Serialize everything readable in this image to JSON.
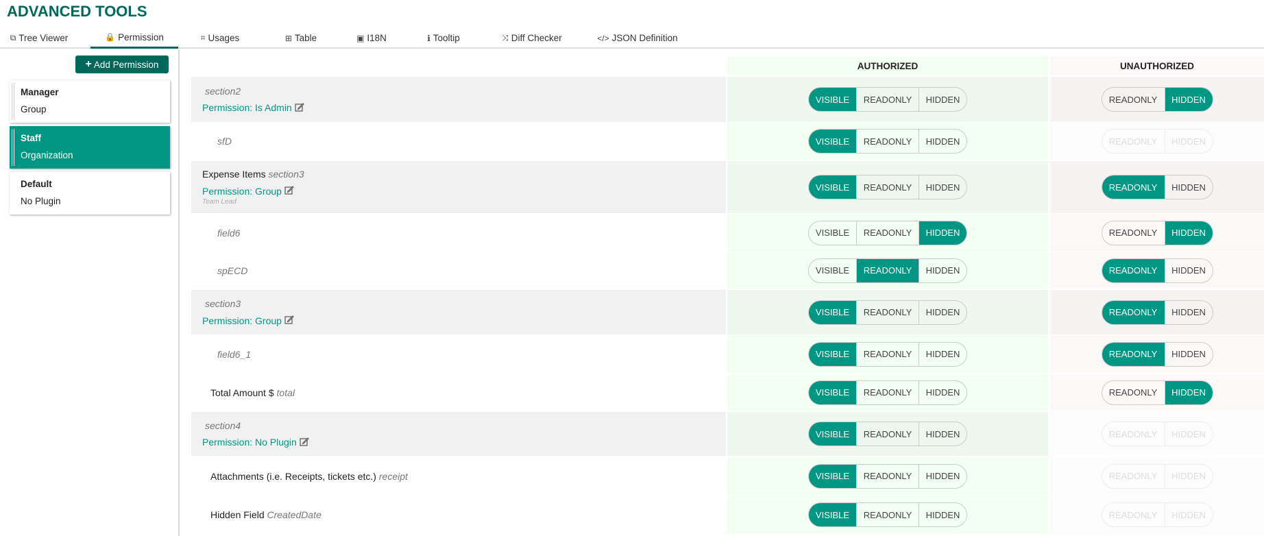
{
  "title": "ADVANCED TOOLS",
  "tabs": [
    {
      "label": "Tree Viewer",
      "icon": "sitemap-icon",
      "glyph": "⧉"
    },
    {
      "label": "Permission",
      "icon": "lock-icon",
      "glyph": "🔒"
    },
    {
      "label": "Usages",
      "icon": "binoculars-icon",
      "glyph": "⌗"
    },
    {
      "label": "Table",
      "icon": "table-icon",
      "glyph": "⊞"
    },
    {
      "label": "I18N",
      "icon": "language-icon",
      "glyph": "▣"
    },
    {
      "label": "Tooltip",
      "icon": "info-icon",
      "glyph": "ℹ"
    },
    {
      "label": "Diff Checker",
      "icon": "random-icon",
      "glyph": "⤨"
    },
    {
      "label": "JSON Definition",
      "icon": "code-icon",
      "glyph": "</>"
    }
  ],
  "add_permission": "Add Permission",
  "roles": [
    {
      "name": "Manager",
      "type": "Group"
    },
    {
      "name": "Staff",
      "type": "Organization"
    },
    {
      "name": "Default",
      "type": "No Plugin"
    }
  ],
  "columns": {
    "authorized": "AUTHORIZED",
    "unauthorized": "UNAUTHORIZED"
  },
  "options": {
    "visible": "VISIBLE",
    "readonly": "READONLY",
    "hidden": "HIDDEN"
  },
  "rows": [
    {
      "kind": "section",
      "label": "",
      "id": "section2",
      "permission": "Permission: Is Admin",
      "note": "",
      "auth": "visible",
      "unauth": "hidden",
      "unauth_disabled": false
    },
    {
      "kind": "field",
      "label": "",
      "id": "sfD",
      "auth": "visible",
      "unauth": "",
      "unauth_disabled": true
    },
    {
      "kind": "section",
      "label": "Expense Items",
      "id": "section3",
      "permission": "Permission: Group",
      "note": "Team Lead",
      "auth": "visible",
      "unauth": "readonly",
      "unauth_disabled": false
    },
    {
      "kind": "field",
      "label": "",
      "id": "field6",
      "auth": "hidden",
      "unauth": "hidden",
      "unauth_disabled": false
    },
    {
      "kind": "field",
      "label": "",
      "id": "spECD",
      "auth": "readonly",
      "unauth": "readonly",
      "unauth_disabled": false
    },
    {
      "kind": "section",
      "label": "",
      "id": "section3",
      "permission": "Permission: Group",
      "note": "",
      "auth": "visible",
      "unauth": "readonly",
      "unauth_disabled": false
    },
    {
      "kind": "field",
      "label": "",
      "id": "field6_1",
      "auth": "visible",
      "unauth": "readonly",
      "unauth_disabled": false
    },
    {
      "kind": "field2",
      "label": "Total Amount $",
      "id": "total",
      "auth": "visible",
      "unauth": "hidden",
      "unauth_disabled": false
    },
    {
      "kind": "section",
      "label": "",
      "id": "section4",
      "permission": "Permission: No Plugin",
      "note": "",
      "auth": "visible",
      "unauth": "",
      "unauth_disabled": true
    },
    {
      "kind": "field2",
      "label": "Attachments (i.e. Receipts, tickets etc.)",
      "id": "receipt",
      "auth": "visible",
      "unauth": "",
      "unauth_disabled": true
    },
    {
      "kind": "field2",
      "label": "Hidden Field",
      "id": "CreatedDate",
      "auth": "visible",
      "unauth": "",
      "unauth_disabled": true
    }
  ]
}
